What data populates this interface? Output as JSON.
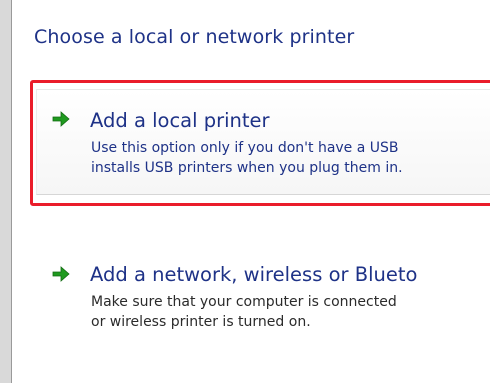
{
  "heading": "Choose a local or network printer",
  "options": [
    {
      "title": "Add a local printer",
      "desc_line1": "Use this option only if you don't have a USB",
      "desc_line2": "installs USB printers when you plug them in.",
      "icon": "green-arrow-right-icon"
    },
    {
      "title": "Add a network, wireless or Blueto",
      "desc_line1": "Make sure that your computer is connected",
      "desc_line2": "or wireless printer is turned on.",
      "icon": "green-arrow-right-icon"
    }
  ],
  "colors": {
    "link_blue": "#1e3287",
    "highlight_red": "#ea1c2a",
    "arrow_green": "#1f9a1f"
  }
}
